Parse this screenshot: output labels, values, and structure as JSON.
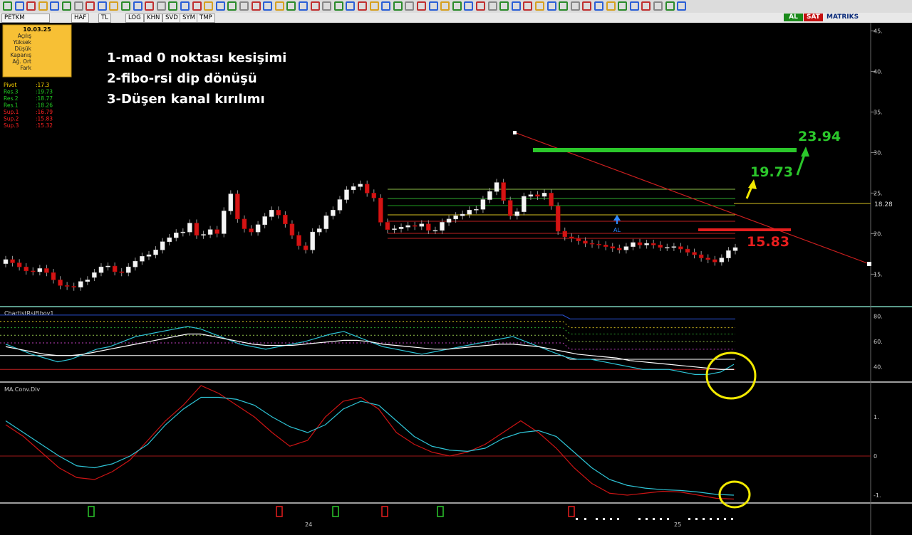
{
  "toolbar": {
    "symbol": "PETKM",
    "tabs": [
      "HAF",
      "TL",
      "LOG",
      "KHN",
      "SVD",
      "SYM",
      "TMP"
    ],
    "buy_label": "AL",
    "sell_label": "SAT",
    "brand": "MATRIKS"
  },
  "info_box": {
    "date": "10.03.25",
    "fields": [
      "Açılış",
      "Yüksek",
      "Düşük",
      "Kapanış",
      "Ağ. Ort",
      "Fark"
    ]
  },
  "pivot_levels": [
    {
      "label": "Pivot",
      "value": ":17.3",
      "color": "#ffd700"
    },
    {
      "label": "Res.3",
      "value": ":19.73",
      "color": "#22cc22"
    },
    {
      "label": "Res.2",
      "value": ":18.77",
      "color": "#22cc22"
    },
    {
      "label": "Res.1",
      "value": ":18.26",
      "color": "#22cc22"
    },
    {
      "label": "Sup.1",
      "value": ":16.79",
      "color": "#ff2222"
    },
    {
      "label": "Sup.2",
      "value": ":15.83",
      "color": "#ff2222"
    },
    {
      "label": "Sup.3",
      "value": ":15.32",
      "color": "#ff2222"
    }
  ],
  "annotations": {
    "note1": "1-mad 0 noktası kesişimi",
    "note2": "2-fibo-rsi dip dönüşü",
    "note3": "3-Düşen kanal kırılımı",
    "target_high": "23.94",
    "target_mid": "19.73",
    "support": "15.83",
    "al_marker": "AL",
    "price_tag": "18.28"
  },
  "chart_data": [
    {
      "type": "candlestick",
      "title": "",
      "yticks": [
        "45.",
        "40.",
        "35.",
        "30.",
        "25.",
        "20.",
        "15."
      ],
      "ylim": [
        11,
        46
      ],
      "closes": [
        16.8,
        16.4,
        15.9,
        15.4,
        15.3,
        15.7,
        15.2,
        14.3,
        13.6,
        13.5,
        13.4,
        14.1,
        14.3,
        15.2,
        15.9,
        16.0,
        15.3,
        15.2,
        15.9,
        16.6,
        17.2,
        17.4,
        18.0,
        19.0,
        19.5,
        20.1,
        20.2,
        21.3,
        19.8,
        19.9,
        20.5,
        20.0,
        22.8,
        24.9,
        21.8,
        20.6,
        20.2,
        21.1,
        22.1,
        22.9,
        22.3,
        21.2,
        19.8,
        18.5,
        18.0,
        20.2,
        20.6,
        22.2,
        22.9,
        24.2,
        25.4,
        25.8,
        26.1,
        25.0,
        24.4,
        21.4,
        20.5,
        20.6,
        20.8,
        21.0,
        20.9,
        21.2,
        20.4,
        20.4,
        21.4,
        21.8,
        22.2,
        22.4,
        22.9,
        23.0,
        24.2,
        25.2,
        26.3,
        24.1,
        22.2,
        22.7,
        24.6,
        24.8,
        24.6,
        25.0,
        23.4,
        20.3,
        19.6,
        19.4,
        19.1,
        18.8,
        18.7,
        18.6,
        18.4,
        18.2,
        18.0,
        18.4,
        18.9,
        18.6,
        18.8,
        18.6,
        18.3,
        18.3,
        18.4,
        18.1,
        17.7,
        17.4,
        17.0,
        16.8,
        16.5,
        17.0,
        17.9,
        18.28
      ],
      "opens": [
        16.3,
        16.8,
        16.4,
        15.9,
        15.4,
        15.3,
        15.7,
        15.2,
        14.3,
        13.6,
        13.5,
        13.4,
        14.1,
        14.6,
        15.2,
        15.9,
        16.0,
        15.3,
        15.2,
        15.9,
        16.6,
        17.2,
        17.4,
        18.0,
        19.0,
        19.5,
        20.1,
        20.2,
        21.3,
        19.8,
        19.9,
        20.5,
        20.0,
        22.8,
        24.9,
        21.8,
        20.6,
        20.2,
        21.1,
        22.1,
        22.9,
        22.3,
        21.2,
        19.8,
        18.5,
        18.0,
        20.2,
        20.6,
        22.2,
        22.9,
        24.2,
        25.4,
        25.8,
        26.1,
        25.0,
        24.4,
        21.4,
        20.5,
        20.6,
        20.8,
        21.0,
        20.9,
        21.2,
        20.4,
        20.4,
        21.4,
        21.8,
        22.2,
        22.4,
        22.9,
        23.0,
        24.2,
        25.2,
        26.3,
        24.1,
        22.2,
        22.7,
        24.6,
        24.8,
        24.6,
        25.0,
        23.4,
        20.3,
        19.6,
        19.4,
        19.1,
        18.8,
        18.7,
        18.6,
        18.4,
        18.2,
        18.0,
        18.4,
        18.9,
        18.6,
        18.8,
        18.6,
        18.3,
        18.3,
        18.4,
        18.1,
        17.7,
        17.4,
        17.0,
        16.8,
        16.5,
        17.0,
        17.9
      ]
    },
    {
      "type": "line",
      "title": "ChartistRsiFibov1",
      "yticks": [
        "80.",
        "60.",
        "40."
      ],
      "ylim": [
        28,
        86
      ],
      "series": [
        {
          "values": [
            58,
            54,
            50,
            47,
            44,
            46,
            50,
            54,
            56,
            60,
            64,
            66,
            68,
            70,
            72,
            70,
            66,
            62,
            58,
            56,
            54,
            56,
            58,
            60,
            63,
            66,
            68,
            64,
            60,
            56,
            54,
            52,
            50,
            52,
            54,
            56,
            58,
            60,
            62,
            64,
            60,
            56,
            52,
            48,
            46,
            46,
            44,
            42,
            40,
            38,
            38,
            38,
            36,
            34,
            34,
            36,
            42
          ]
        },
        {
          "values": [
            56,
            54,
            52,
            50,
            49,
            49,
            50,
            52,
            54,
            56,
            58,
            60,
            62,
            64,
            66,
            66,
            64,
            62,
            60,
            58,
            57,
            57,
            57,
            58,
            59,
            60,
            61,
            61,
            60,
            58,
            57,
            56,
            55,
            54,
            54,
            55,
            56,
            57,
            58,
            58,
            57,
            56,
            54,
            52,
            50,
            49,
            48,
            47,
            45,
            44,
            43,
            42,
            41,
            40,
            39,
            38,
            38
          ]
        }
      ]
    },
    {
      "type": "line",
      "title": "MA.Conv.Div",
      "yticks": [
        "1.",
        "0",
        "-1."
      ],
      "ylim": [
        -1.2,
        1.8
      ],
      "series": [
        {
          "values": [
            0.8,
            0.5,
            0.1,
            -0.3,
            -0.55,
            -0.6,
            -0.4,
            -0.1,
            0.4,
            0.9,
            1.3,
            1.8,
            1.6,
            1.3,
            1.0,
            0.6,
            0.25,
            0.4,
            1.0,
            1.4,
            1.5,
            1.2,
            0.6,
            0.3,
            0.1,
            0.0,
            0.1,
            0.3,
            0.6,
            0.9,
            0.6,
            0.2,
            -0.3,
            -0.7,
            -0.95,
            -1.0,
            -0.95,
            -0.9,
            -0.92,
            -1.0,
            -1.08,
            -1.1
          ]
        },
        {
          "values": [
            0.9,
            0.6,
            0.3,
            0.0,
            -0.25,
            -0.3,
            -0.2,
            0.0,
            0.3,
            0.8,
            1.2,
            1.5,
            1.5,
            1.45,
            1.3,
            1.0,
            0.75,
            0.6,
            0.8,
            1.2,
            1.4,
            1.3,
            0.9,
            0.5,
            0.25,
            0.15,
            0.12,
            0.2,
            0.45,
            0.6,
            0.65,
            0.5,
            0.1,
            -0.3,
            -0.6,
            -0.75,
            -0.82,
            -0.86,
            -0.88,
            -0.92,
            -0.98,
            -1.0
          ]
        }
      ]
    }
  ],
  "time_axis": {
    "labels": [
      "24",
      "25"
    ]
  }
}
